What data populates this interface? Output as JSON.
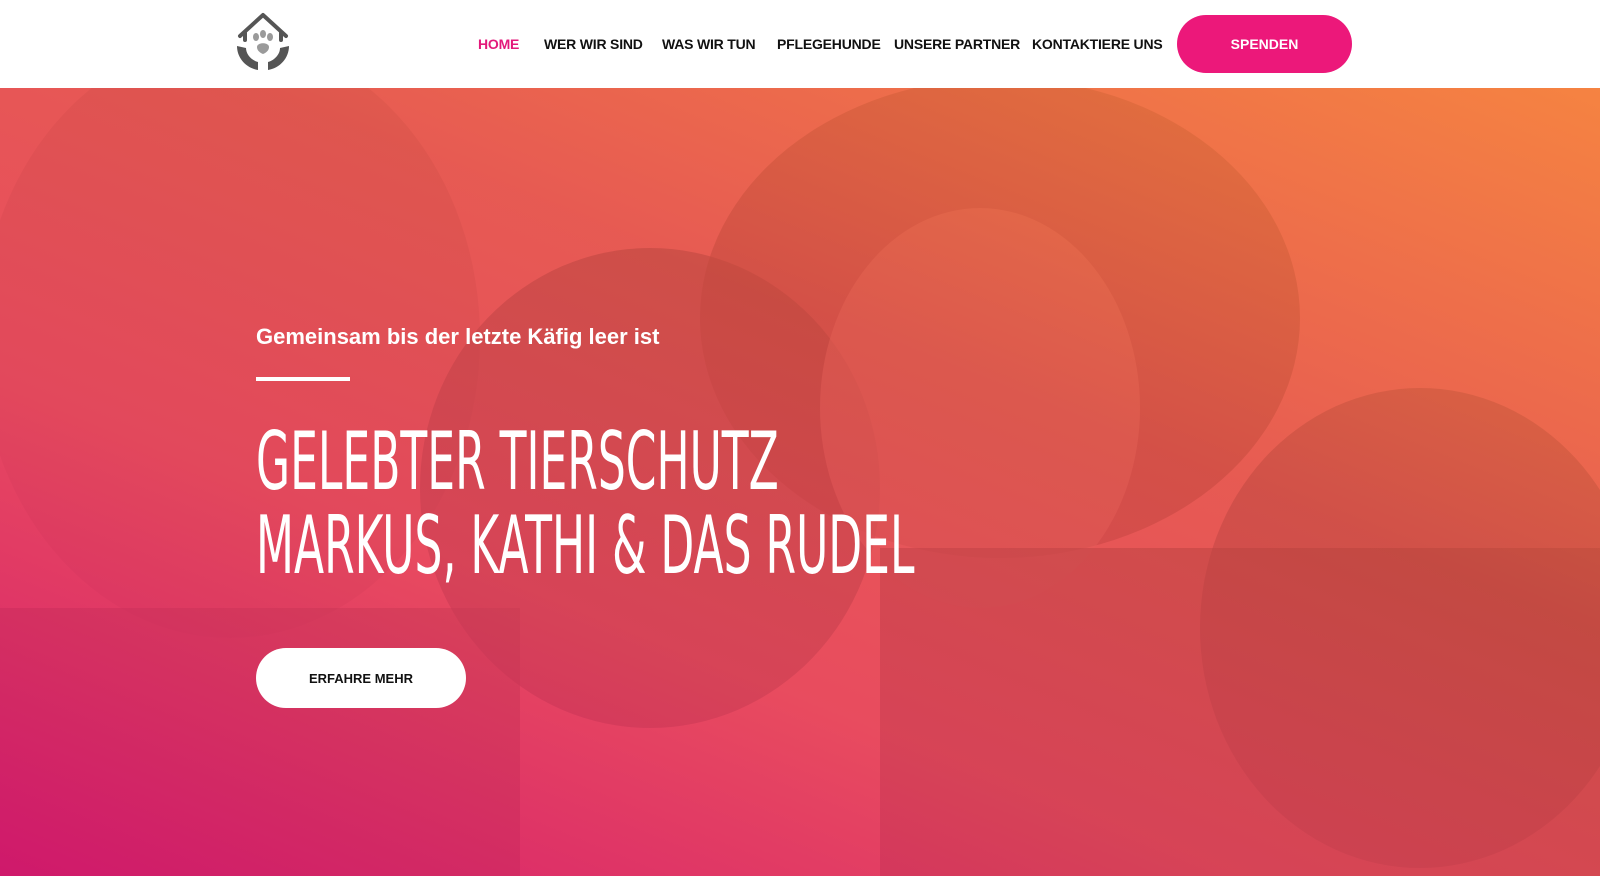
{
  "header": {
    "logo_icon": "house-hands-paw-icon",
    "nav": [
      {
        "label": "HOME",
        "active": true
      },
      {
        "label": "WER WIR SIND",
        "active": false
      },
      {
        "label": "WAS WIR TUN",
        "active": false
      },
      {
        "label": "PFLEGEHUNDE",
        "active": false
      },
      {
        "label": "UNSERE PARTNER",
        "active": false
      },
      {
        "label": "KONTAKTIERE UNS",
        "active": false
      }
    ],
    "donate_label": "SPENDEN"
  },
  "hero": {
    "eyebrow": "Gemeinsam bis der letzte Käfig leer ist",
    "title_line1": "Gelebter Tierschutz",
    "title_line2": "Markus, Kathi & das Rudel",
    "cta_label": "ERFAHRE MEHR",
    "background": "photo-two-people-with-dog"
  },
  "colors": {
    "accent": "#ec187a",
    "active_nav": "#e3197b",
    "gradient_start": "#d61670",
    "gradient_end": "#ff8c3c"
  }
}
